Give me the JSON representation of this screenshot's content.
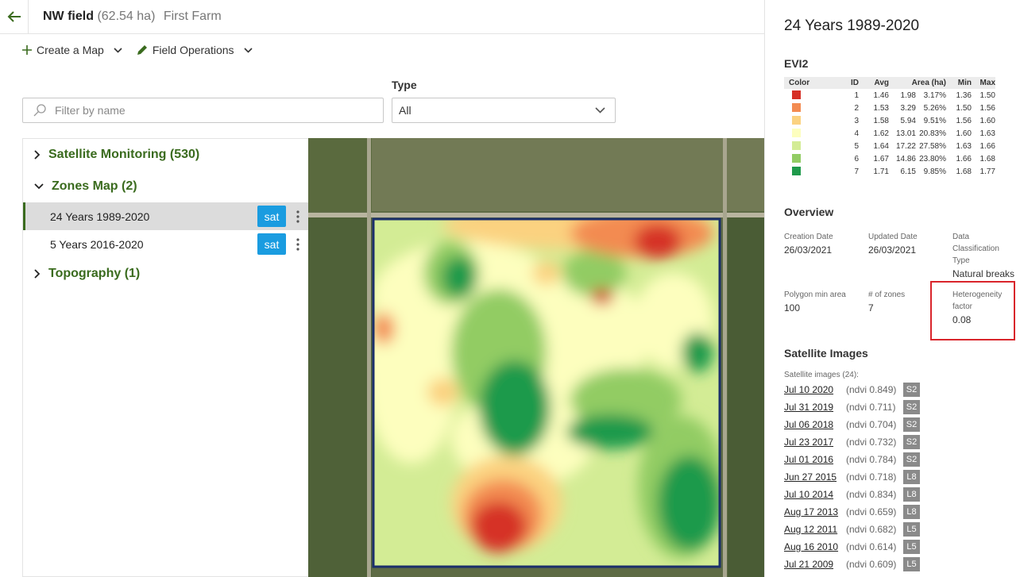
{
  "header": {
    "field_name": "NW field",
    "area": "(62.54 ha)",
    "farm": "First Farm"
  },
  "actions": {
    "create_map": "Create a Map",
    "field_operations": "Field Operations"
  },
  "filters": {
    "search_placeholder": "Filter by name",
    "type_label": "Type",
    "type_value": "All"
  },
  "tree": {
    "satellite_monitoring": "Satellite Monitoring (530)",
    "zones_map": "Zones Map (2)",
    "items": [
      {
        "label": "24 Years 1989-2020",
        "badge": "sat"
      },
      {
        "label": "5 Years 2016-2020",
        "badge": "sat"
      }
    ],
    "topography": "Topography (1)"
  },
  "panel": {
    "title": "24 Years 1989-2020",
    "index": "EVI2",
    "table_headers": {
      "color": "Color",
      "id": "ID",
      "avg": "Avg",
      "area": "Area (ha)",
      "min": "Min",
      "max": "Max"
    },
    "zones": [
      {
        "id": "1",
        "avg": "1.46",
        "area": "1.98",
        "pct": "3.17%",
        "min": "1.36",
        "max": "1.50",
        "color": "#d63027"
      },
      {
        "id": "2",
        "avg": "1.53",
        "area": "3.29",
        "pct": "5.26%",
        "min": "1.50",
        "max": "1.56",
        "color": "#f38b51"
      },
      {
        "id": "3",
        "avg": "1.58",
        "area": "5.94",
        "pct": "9.51%",
        "min": "1.56",
        "max": "1.60",
        "color": "#fbd280"
      },
      {
        "id": "4",
        "avg": "1.62",
        "area": "13.01",
        "pct": "20.83%",
        "min": "1.60",
        "max": "1.63",
        "color": "#fdfebe"
      },
      {
        "id": "5",
        "avg": "1.64",
        "area": "17.22",
        "pct": "27.58%",
        "min": "1.63",
        "max": "1.66",
        "color": "#d3ec95"
      },
      {
        "id": "6",
        "avg": "1.67",
        "area": "14.86",
        "pct": "23.80%",
        "min": "1.66",
        "max": "1.68",
        "color": "#92cc64"
      },
      {
        "id": "7",
        "avg": "1.71",
        "area": "6.15",
        "pct": "9.85%",
        "min": "1.68",
        "max": "1.77",
        "color": "#1f9a4b"
      }
    ],
    "overview_title": "Overview",
    "creation_date_label": "Creation Date",
    "creation_date": "26/03/2021",
    "updated_date_label": "Updated Date",
    "updated_date": "26/03/2021",
    "classification_label": "Data Classification Type",
    "classification": "Natural breaks",
    "polygon_label": "Polygon min area",
    "polygon_value": "100",
    "zones_label": "# of zones",
    "zones_value": "7",
    "heterogeneity_label": "Heterogeneity factor",
    "heterogeneity_value": "0.08",
    "sat_images_title": "Satellite Images",
    "sat_images_sub": "Satellite images (24):",
    "sat_images": [
      {
        "date": "Jul 10 2020",
        "ndvi": "(ndvi 0.849)",
        "src": "S2"
      },
      {
        "date": "Jul 31 2019",
        "ndvi": "(ndvi 0.711)",
        "src": "S2"
      },
      {
        "date": "Jul 06 2018",
        "ndvi": "(ndvi 0.704)",
        "src": "S2"
      },
      {
        "date": "Jul 23 2017",
        "ndvi": "(ndvi 0.732)",
        "src": "S2"
      },
      {
        "date": "Jul 01 2016",
        "ndvi": "(ndvi 0.784)",
        "src": "S2"
      },
      {
        "date": "Jun 27 2015",
        "ndvi": "(ndvi 0.718)",
        "src": "L8"
      },
      {
        "date": "Jul 10 2014",
        "ndvi": "(ndvi 0.834)",
        "src": "L8"
      },
      {
        "date": "Aug 17 2013",
        "ndvi": "(ndvi 0.659)",
        "src": "L8"
      },
      {
        "date": "Aug 12 2011",
        "ndvi": "(ndvi 0.682)",
        "src": "L5"
      },
      {
        "date": "Aug 16 2010",
        "ndvi": "(ndvi 0.614)",
        "src": "L5"
      },
      {
        "date": "Jul 21 2009",
        "ndvi": "(ndvi 0.609)",
        "src": "L5"
      }
    ]
  },
  "colors": {
    "brand_green": "#3a6b1e",
    "sat_badge": "#1a9ce0",
    "highlight": "#d9252b",
    "field_border": "#1b2f6b"
  }
}
